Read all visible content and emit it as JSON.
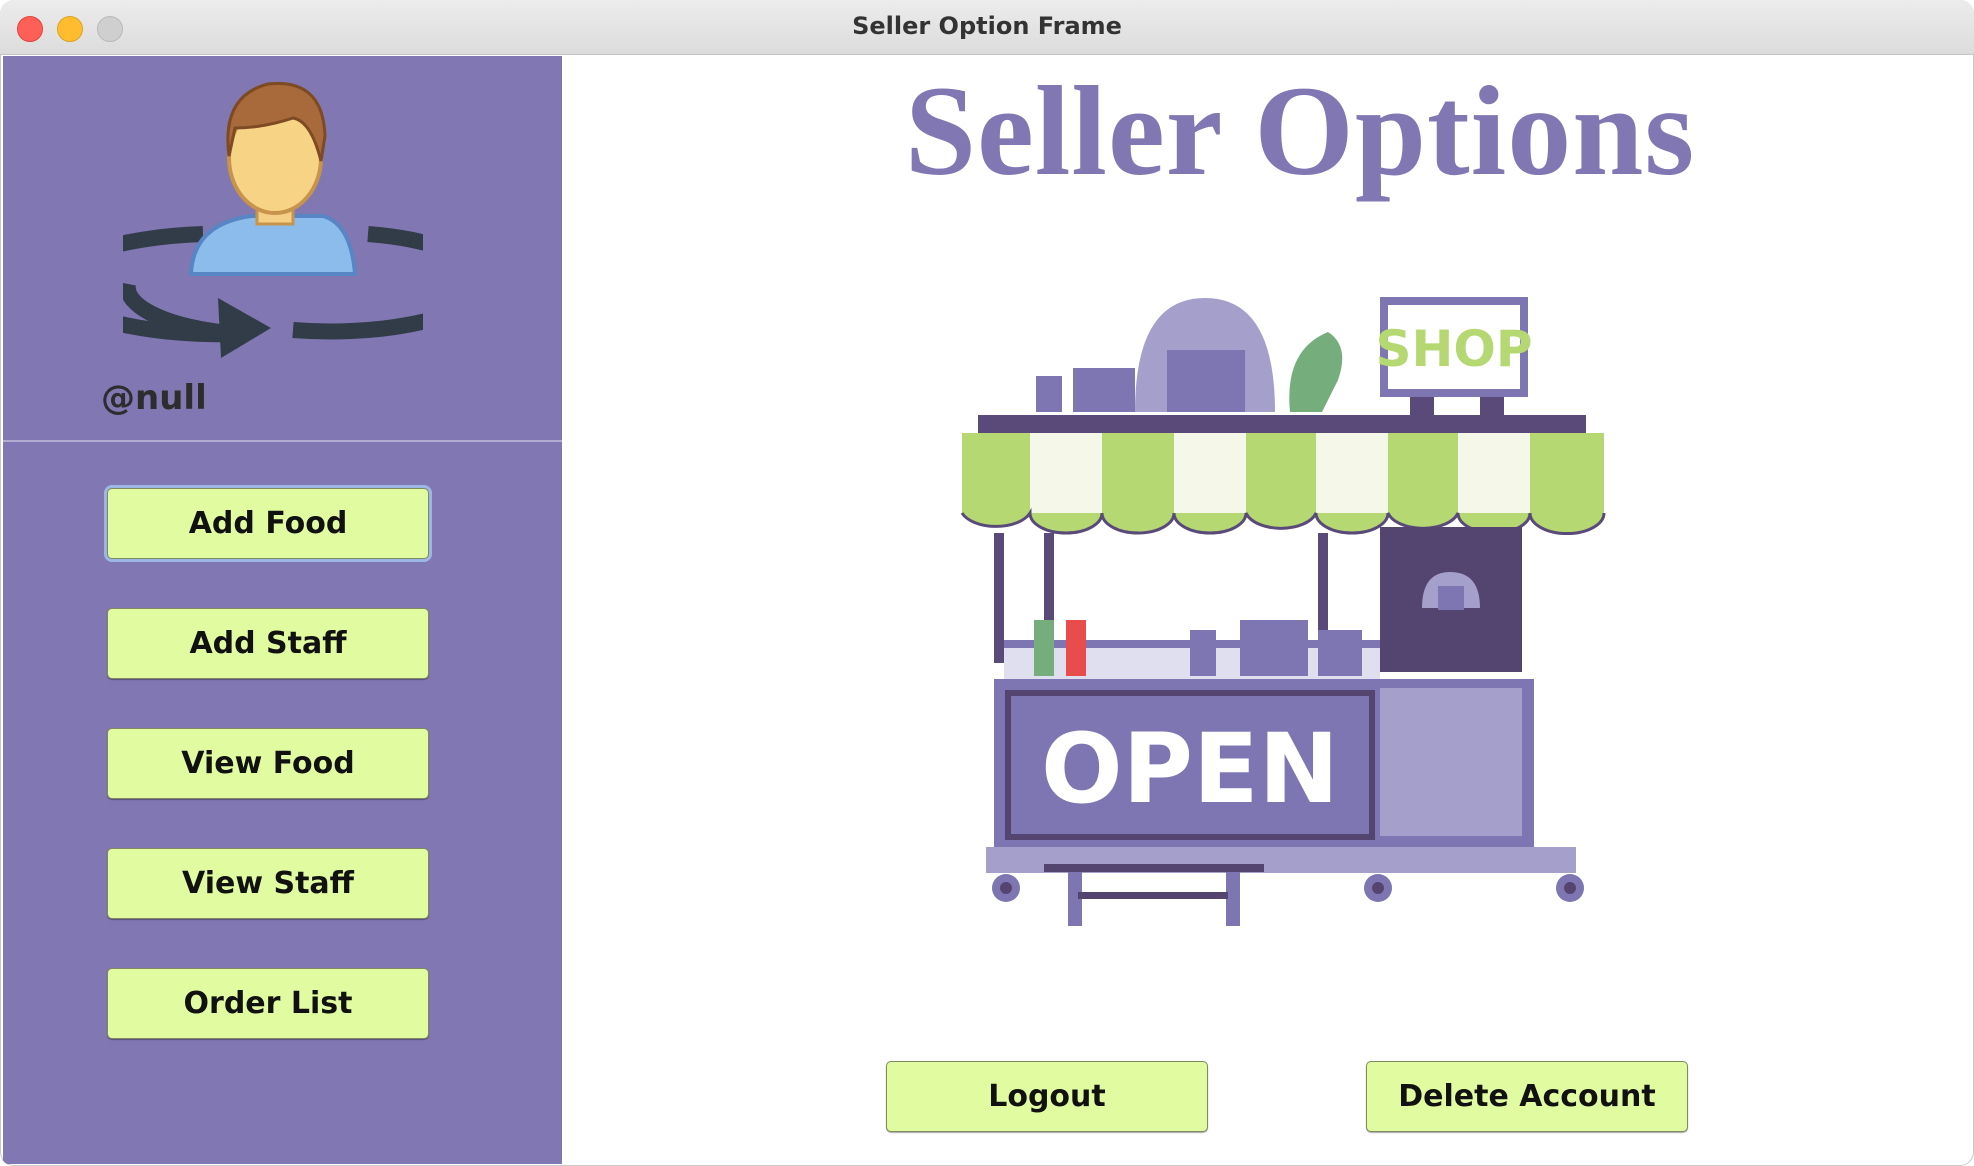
{
  "window": {
    "title": "Seller Option Frame"
  },
  "profile": {
    "username": "@null",
    "avatar_icon": "user-switch-icon"
  },
  "sidebar": {
    "items": [
      {
        "label": "Add Food"
      },
      {
        "label": "Add Staff"
      },
      {
        "label": "View Food"
      },
      {
        "label": "View Staff"
      },
      {
        "label": "Order List"
      }
    ]
  },
  "main": {
    "heading": "Seller Options",
    "illustration": {
      "icon": "food-stall-illustration",
      "shop_sign": "SHOP",
      "open_sign": "OPEN"
    },
    "logout_label": "Logout",
    "delete_label": "Delete Account"
  },
  "colors": {
    "sidebar_bg": "#8178b3",
    "button_bg": "#e1fba1",
    "heading": "#8178b3"
  }
}
